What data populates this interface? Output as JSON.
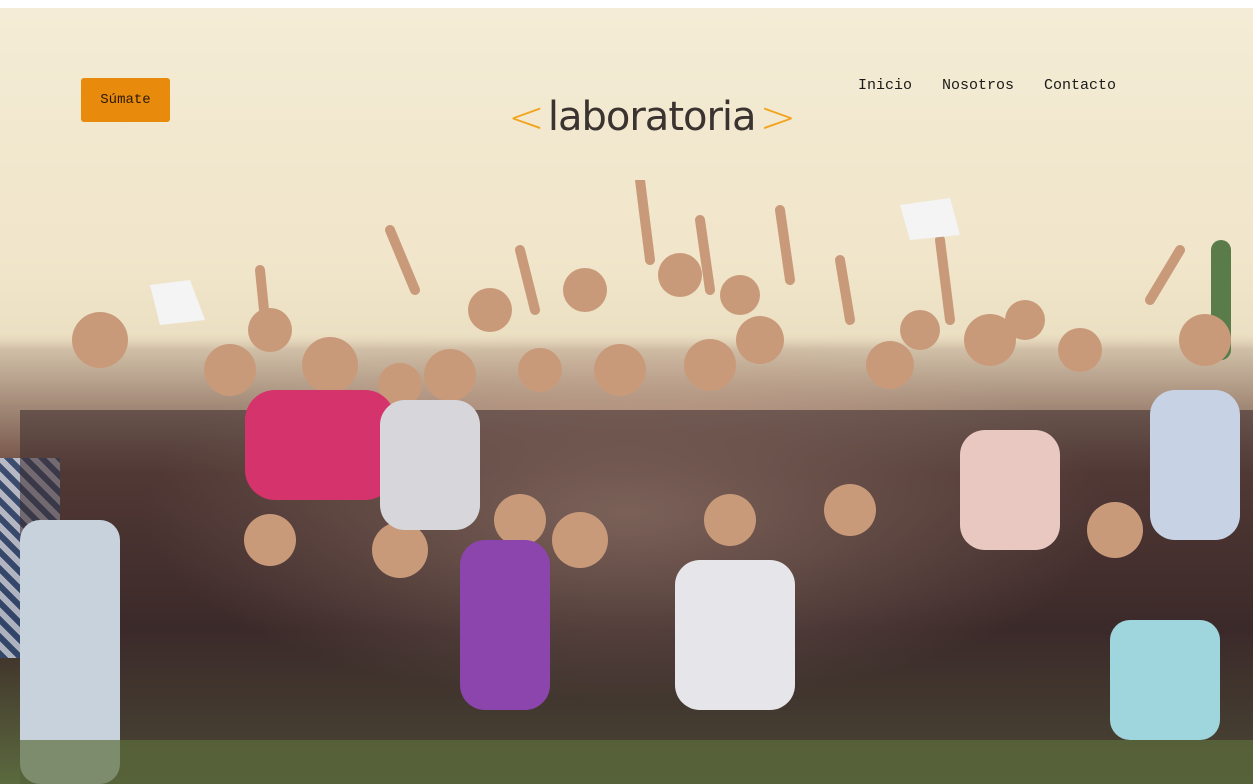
{
  "header": {
    "join_button_label": "Súmate",
    "logo": {
      "left_bracket": "<",
      "word": "laboratoria",
      "right_bracket": ">"
    },
    "nav": [
      {
        "label": "Inicio"
      },
      {
        "label": "Nosotros"
      },
      {
        "label": "Contacto"
      }
    ]
  },
  "colors": {
    "accent": "#e88b0c",
    "logo_bracket": "#f3a41d",
    "logo_text": "#3a3330"
  },
  "hero": {
    "image": "group-photo-of-students-celebrating"
  }
}
